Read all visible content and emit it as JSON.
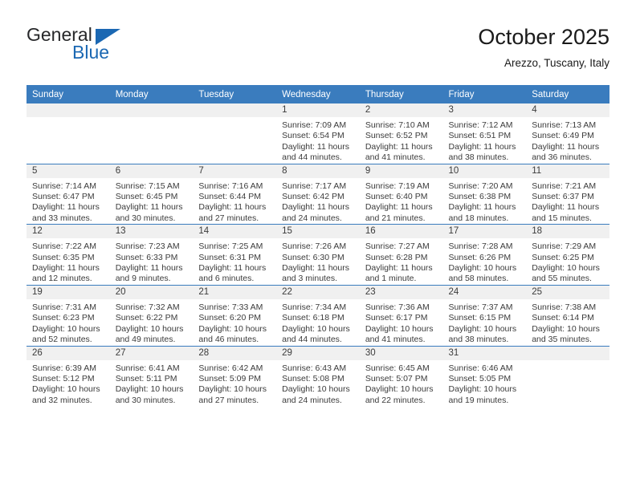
{
  "brand": {
    "name_part1": "General",
    "name_part2": "Blue",
    "triangle_color": "#1b68b3"
  },
  "header": {
    "title": "October 2025",
    "subtitle": "Arezzo, Tuscany, Italy",
    "accent_color": "#3a7cbe"
  },
  "weekdays": [
    "Sunday",
    "Monday",
    "Tuesday",
    "Wednesday",
    "Thursday",
    "Friday",
    "Saturday"
  ],
  "weeks": [
    [
      {
        "day": "",
        "sunrise": "",
        "sunset": "",
        "daylight1": "",
        "daylight2": ""
      },
      {
        "day": "",
        "sunrise": "",
        "sunset": "",
        "daylight1": "",
        "daylight2": ""
      },
      {
        "day": "",
        "sunrise": "",
        "sunset": "",
        "daylight1": "",
        "daylight2": ""
      },
      {
        "day": "1",
        "sunrise": "Sunrise: 7:09 AM",
        "sunset": "Sunset: 6:54 PM",
        "daylight1": "Daylight: 11 hours",
        "daylight2": "and 44 minutes."
      },
      {
        "day": "2",
        "sunrise": "Sunrise: 7:10 AM",
        "sunset": "Sunset: 6:52 PM",
        "daylight1": "Daylight: 11 hours",
        "daylight2": "and 41 minutes."
      },
      {
        "day": "3",
        "sunrise": "Sunrise: 7:12 AM",
        "sunset": "Sunset: 6:51 PM",
        "daylight1": "Daylight: 11 hours",
        "daylight2": "and 38 minutes."
      },
      {
        "day": "4",
        "sunrise": "Sunrise: 7:13 AM",
        "sunset": "Sunset: 6:49 PM",
        "daylight1": "Daylight: 11 hours",
        "daylight2": "and 36 minutes."
      }
    ],
    [
      {
        "day": "5",
        "sunrise": "Sunrise: 7:14 AM",
        "sunset": "Sunset: 6:47 PM",
        "daylight1": "Daylight: 11 hours",
        "daylight2": "and 33 minutes."
      },
      {
        "day": "6",
        "sunrise": "Sunrise: 7:15 AM",
        "sunset": "Sunset: 6:45 PM",
        "daylight1": "Daylight: 11 hours",
        "daylight2": "and 30 minutes."
      },
      {
        "day": "7",
        "sunrise": "Sunrise: 7:16 AM",
        "sunset": "Sunset: 6:44 PM",
        "daylight1": "Daylight: 11 hours",
        "daylight2": "and 27 minutes."
      },
      {
        "day": "8",
        "sunrise": "Sunrise: 7:17 AM",
        "sunset": "Sunset: 6:42 PM",
        "daylight1": "Daylight: 11 hours",
        "daylight2": "and 24 minutes."
      },
      {
        "day": "9",
        "sunrise": "Sunrise: 7:19 AM",
        "sunset": "Sunset: 6:40 PM",
        "daylight1": "Daylight: 11 hours",
        "daylight2": "and 21 minutes."
      },
      {
        "day": "10",
        "sunrise": "Sunrise: 7:20 AM",
        "sunset": "Sunset: 6:38 PM",
        "daylight1": "Daylight: 11 hours",
        "daylight2": "and 18 minutes."
      },
      {
        "day": "11",
        "sunrise": "Sunrise: 7:21 AM",
        "sunset": "Sunset: 6:37 PM",
        "daylight1": "Daylight: 11 hours",
        "daylight2": "and 15 minutes."
      }
    ],
    [
      {
        "day": "12",
        "sunrise": "Sunrise: 7:22 AM",
        "sunset": "Sunset: 6:35 PM",
        "daylight1": "Daylight: 11 hours",
        "daylight2": "and 12 minutes."
      },
      {
        "day": "13",
        "sunrise": "Sunrise: 7:23 AM",
        "sunset": "Sunset: 6:33 PM",
        "daylight1": "Daylight: 11 hours",
        "daylight2": "and 9 minutes."
      },
      {
        "day": "14",
        "sunrise": "Sunrise: 7:25 AM",
        "sunset": "Sunset: 6:31 PM",
        "daylight1": "Daylight: 11 hours",
        "daylight2": "and 6 minutes."
      },
      {
        "day": "15",
        "sunrise": "Sunrise: 7:26 AM",
        "sunset": "Sunset: 6:30 PM",
        "daylight1": "Daylight: 11 hours",
        "daylight2": "and 3 minutes."
      },
      {
        "day": "16",
        "sunrise": "Sunrise: 7:27 AM",
        "sunset": "Sunset: 6:28 PM",
        "daylight1": "Daylight: 11 hours",
        "daylight2": "and 1 minute."
      },
      {
        "day": "17",
        "sunrise": "Sunrise: 7:28 AM",
        "sunset": "Sunset: 6:26 PM",
        "daylight1": "Daylight: 10 hours",
        "daylight2": "and 58 minutes."
      },
      {
        "day": "18",
        "sunrise": "Sunrise: 7:29 AM",
        "sunset": "Sunset: 6:25 PM",
        "daylight1": "Daylight: 10 hours",
        "daylight2": "and 55 minutes."
      }
    ],
    [
      {
        "day": "19",
        "sunrise": "Sunrise: 7:31 AM",
        "sunset": "Sunset: 6:23 PM",
        "daylight1": "Daylight: 10 hours",
        "daylight2": "and 52 minutes."
      },
      {
        "day": "20",
        "sunrise": "Sunrise: 7:32 AM",
        "sunset": "Sunset: 6:22 PM",
        "daylight1": "Daylight: 10 hours",
        "daylight2": "and 49 minutes."
      },
      {
        "day": "21",
        "sunrise": "Sunrise: 7:33 AM",
        "sunset": "Sunset: 6:20 PM",
        "daylight1": "Daylight: 10 hours",
        "daylight2": "and 46 minutes."
      },
      {
        "day": "22",
        "sunrise": "Sunrise: 7:34 AM",
        "sunset": "Sunset: 6:18 PM",
        "daylight1": "Daylight: 10 hours",
        "daylight2": "and 44 minutes."
      },
      {
        "day": "23",
        "sunrise": "Sunrise: 7:36 AM",
        "sunset": "Sunset: 6:17 PM",
        "daylight1": "Daylight: 10 hours",
        "daylight2": "and 41 minutes."
      },
      {
        "day": "24",
        "sunrise": "Sunrise: 7:37 AM",
        "sunset": "Sunset: 6:15 PM",
        "daylight1": "Daylight: 10 hours",
        "daylight2": "and 38 minutes."
      },
      {
        "day": "25",
        "sunrise": "Sunrise: 7:38 AM",
        "sunset": "Sunset: 6:14 PM",
        "daylight1": "Daylight: 10 hours",
        "daylight2": "and 35 minutes."
      }
    ],
    [
      {
        "day": "26",
        "sunrise": "Sunrise: 6:39 AM",
        "sunset": "Sunset: 5:12 PM",
        "daylight1": "Daylight: 10 hours",
        "daylight2": "and 32 minutes."
      },
      {
        "day": "27",
        "sunrise": "Sunrise: 6:41 AM",
        "sunset": "Sunset: 5:11 PM",
        "daylight1": "Daylight: 10 hours",
        "daylight2": "and 30 minutes."
      },
      {
        "day": "28",
        "sunrise": "Sunrise: 6:42 AM",
        "sunset": "Sunset: 5:09 PM",
        "daylight1": "Daylight: 10 hours",
        "daylight2": "and 27 minutes."
      },
      {
        "day": "29",
        "sunrise": "Sunrise: 6:43 AM",
        "sunset": "Sunset: 5:08 PM",
        "daylight1": "Daylight: 10 hours",
        "daylight2": "and 24 minutes."
      },
      {
        "day": "30",
        "sunrise": "Sunrise: 6:45 AM",
        "sunset": "Sunset: 5:07 PM",
        "daylight1": "Daylight: 10 hours",
        "daylight2": "and 22 minutes."
      },
      {
        "day": "31",
        "sunrise": "Sunrise: 6:46 AM",
        "sunset": "Sunset: 5:05 PM",
        "daylight1": "Daylight: 10 hours",
        "daylight2": "and 19 minutes."
      },
      {
        "day": "",
        "sunrise": "",
        "sunset": "",
        "daylight1": "",
        "daylight2": ""
      }
    ]
  ]
}
